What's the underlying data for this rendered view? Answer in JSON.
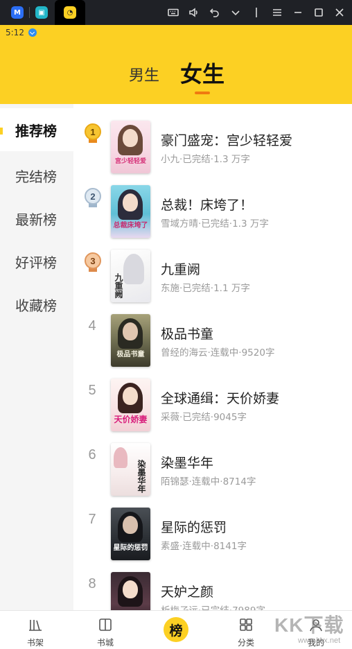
{
  "emulator": {
    "icons": [
      "app-switcher-m-icon",
      "app-tv-icon",
      "app-reader-icon"
    ],
    "controls": [
      "keyboard-icon",
      "volume-icon",
      "back-icon",
      "chevron-down-icon",
      "menu-icon",
      "minimize-icon",
      "maximize-icon",
      "close-icon"
    ]
  },
  "status_bar": {
    "time": "5:12"
  },
  "header": {
    "tabs": [
      {
        "label": "男生",
        "selected": false
      },
      {
        "label": "女生",
        "selected": true
      }
    ]
  },
  "side_nav": {
    "items": [
      {
        "label": "推荐榜",
        "selected": true
      },
      {
        "label": "完结榜",
        "selected": false
      },
      {
        "label": "最新榜",
        "selected": false
      },
      {
        "label": "好评榜",
        "selected": false
      },
      {
        "label": "收藏榜",
        "selected": false
      }
    ]
  },
  "ranking": {
    "books": [
      {
        "rank": "1",
        "title": "豪门盛宠：宫少轻轻爱",
        "meta": "小九·已完结·1.3 万字",
        "cover_text": "宫少轻轻爱"
      },
      {
        "rank": "2",
        "title": "总裁！床垮了！",
        "meta": "雪域方晴·已完结·1.3 万字",
        "cover_text": "总裁床垮了"
      },
      {
        "rank": "3",
        "title": "九重阙",
        "meta": "东施·已完结·1.1 万字",
        "cover_text": "九重阙"
      },
      {
        "rank": "4",
        "title": "极品书童",
        "meta": "曾经的海云·连载中·9520字",
        "cover_text": "极品书童"
      },
      {
        "rank": "5",
        "title": "全球通缉：天价娇妻",
        "meta": "采薇·已完结·9045字",
        "cover_text": "天价娇妻"
      },
      {
        "rank": "6",
        "title": "染墨华年",
        "meta": "陌锦瑟·连载中·8714字",
        "cover_text": "染墨华年"
      },
      {
        "rank": "7",
        "title": "星际的惩罚",
        "meta": "素盛·连载中·8141字",
        "cover_text": "星际的惩罚"
      },
      {
        "rank": "8",
        "title": "天妒之颜",
        "meta": "析梅孑远·已完结·7989字",
        "cover_text": ""
      }
    ]
  },
  "bottom_nav": {
    "items": [
      {
        "label": "书架"
      },
      {
        "label": "书城"
      },
      {
        "label": "榜"
      },
      {
        "label": "分类"
      },
      {
        "label": "我的"
      }
    ]
  },
  "watermark": {
    "text": "KK下载",
    "url": "www.kkx.net"
  },
  "colors": {
    "accent": "#fcd023",
    "indicator": "#f07a10",
    "sidebar_bg": "#f5f5f5"
  }
}
